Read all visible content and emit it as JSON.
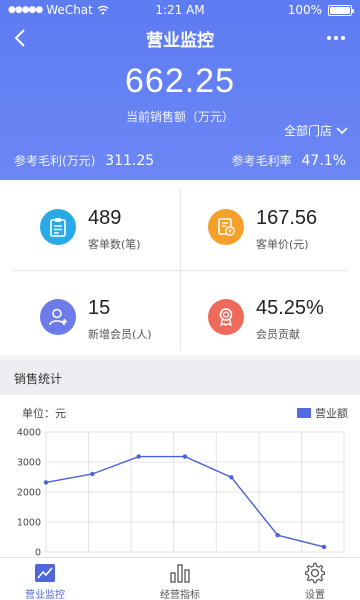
{
  "status_bar": {
    "carrier": "WeChat",
    "time": "1:21 AM",
    "battery": "100%"
  },
  "nav": {
    "title": "营业监控"
  },
  "summary": {
    "amount": "662.25",
    "amount_label": "当前销售额（万元）",
    "store_filter": "全部门店"
  },
  "reference": {
    "profit_label": "参考毛利(万元)",
    "profit_value": "311.25",
    "margin_label": "参考毛利率",
    "margin_value": "47.1%"
  },
  "kpis": [
    {
      "value": "489",
      "label": "客单数(笔)",
      "icon": "clipboard-icon",
      "color": "#29a9e6"
    },
    {
      "value": "167.56",
      "label": "客单价(元)",
      "icon": "invoice-icon",
      "color": "#f5a02a"
    },
    {
      "value": "15",
      "label": "新增会员(人)",
      "icon": "add-user-icon",
      "color": "#6b7be8"
    },
    {
      "value": "45.25%",
      "label": "会员贡献",
      "icon": "award-icon",
      "color": "#f06a5c"
    }
  ],
  "section": {
    "title": "销售统计"
  },
  "chart_data": {
    "type": "line",
    "unit_label": "单位：元",
    "y_ticks": [
      "4000",
      "3000",
      "2000",
      "1000",
      "0"
    ],
    "ylim": [
      0,
      4000
    ],
    "grid": true,
    "legend_position": "top-right",
    "series": [
      {
        "name": "营业额",
        "color": "#4a62d8",
        "values": [
          2320,
          2600,
          3180,
          3180,
          2490,
          560,
          170
        ]
      }
    ]
  },
  "tabbar": {
    "items": [
      {
        "label": "营业监控",
        "icon": "line-chart-icon",
        "active": true
      },
      {
        "label": "经营指标",
        "icon": "bar-chart-icon",
        "active": false
      },
      {
        "label": "设置",
        "icon": "gear-icon",
        "active": false
      }
    ]
  }
}
